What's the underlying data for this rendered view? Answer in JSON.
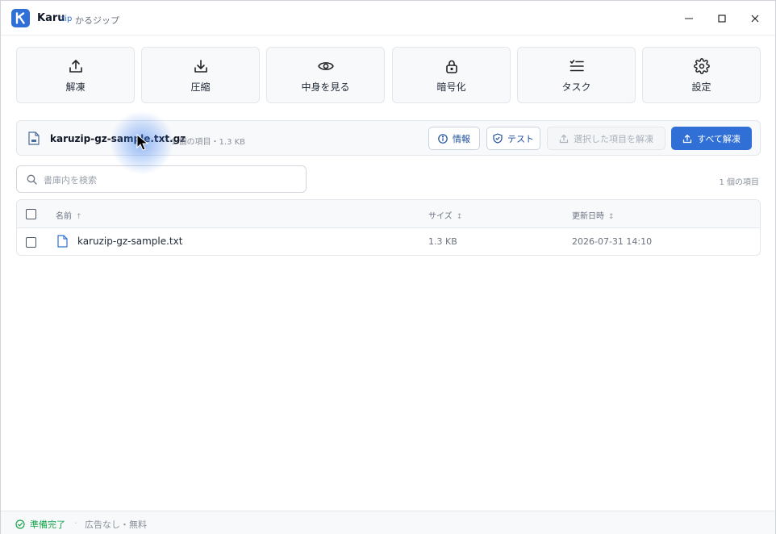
{
  "titlebar": {
    "app_name": "Karu",
    "app_name_suffix": "zip",
    "app_subtitle": "かるジップ",
    "logo_letter": "K",
    "minimize_icon": "—",
    "maximize_icon": "☐",
    "close_icon": "✕"
  },
  "toolbar": {
    "extract_label": "解凍",
    "compress_label": "圧縮",
    "view_label": "中身を見る",
    "encrypt_label": "暗号化",
    "tasks_label": "タスク",
    "settings_label": "設定"
  },
  "file_info": {
    "file_name": "karuzip-gz-sample.txt.gz",
    "meta": "1 個の項目・1.3 KB",
    "info_label": "情報",
    "test_label": "テスト",
    "extract_selected_label": "選択した項目を解凍",
    "extract_all_label": "すべて解凍"
  },
  "search": {
    "placeholder": "書庫内を検索",
    "value": ""
  },
  "item_count": "1 個の項目",
  "table": {
    "columns": [
      {
        "label": "名前",
        "sort": "↑"
      },
      {
        "label": "サイズ",
        "sort": "↕"
      },
      {
        "label": "更新日時",
        "sort": "↕"
      }
    ],
    "rows": [
      {
        "name": "karuzip-gz-sample.txt",
        "size": "1.3 KB",
        "modified": "2026-07-31 14:10"
      }
    ]
  },
  "statusbar": {
    "status": "準備完了",
    "separator": "·",
    "note": "広告なし・無料"
  },
  "colors": {
    "accent": "#2f6fd6",
    "success": "#16a34a"
  }
}
